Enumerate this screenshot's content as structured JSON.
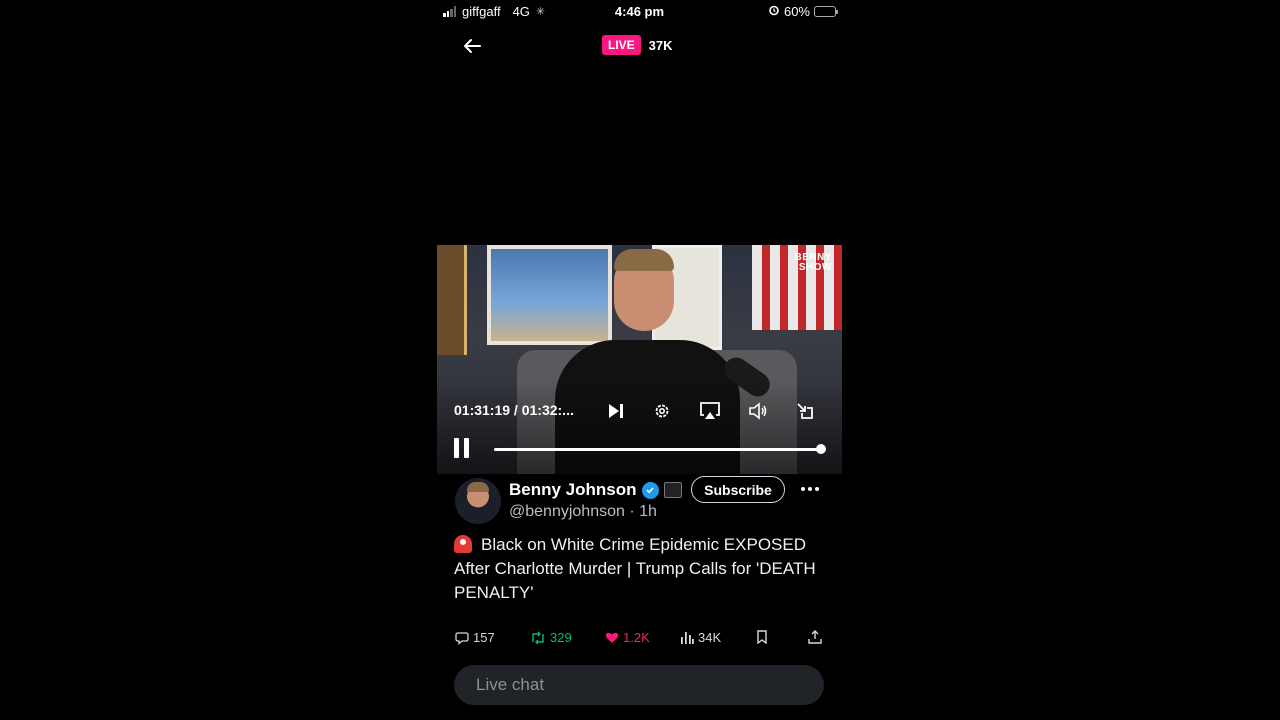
{
  "status_bar": {
    "carrier": "giffgaff",
    "network": "4G",
    "time": "4:46 pm",
    "battery": "60%",
    "battery_fraction": 0.6
  },
  "top_nav": {
    "live_label": "LIVE",
    "viewer_count": "37K"
  },
  "video": {
    "logo_line1": "BENNY",
    "logo_line2": "SHOW",
    "time_readout": "01:31:19 / 01:32:...",
    "progress_fraction": 0.99
  },
  "tweet": {
    "display_name": "Benny Johnson",
    "handle": "@bennyjohnson",
    "time_ago": "1h",
    "subscribe_label": "Subscribe",
    "text": "Black on White Crime Epidemic EXPOSED After Charlotte Murder |  Trump Calls for 'DEATH PENALTY'",
    "replies": "157",
    "reposts": "329",
    "likes": "1.2K",
    "views": "34K"
  },
  "chat": {
    "placeholder": "Live chat"
  },
  "colors": {
    "live_pink": "#f91880",
    "repost_green": "#00ba7c",
    "verified_blue": "#1d9bf0"
  }
}
